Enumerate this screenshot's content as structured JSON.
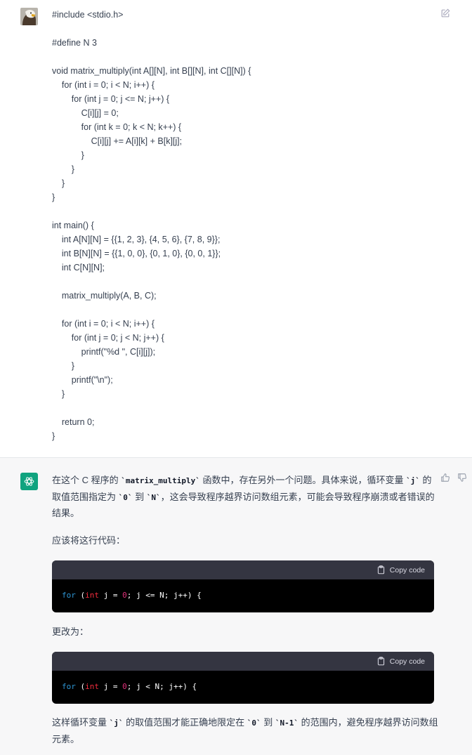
{
  "user_message": {
    "code_lines": [
      "#include <stdio.h>",
      "",
      "#define N 3",
      "",
      "void matrix_multiply(int A[][N], int B[][N], int C[][N]) {",
      "    for (int i = 0; i < N; i++) {",
      "        for (int j = 0; j <= N; j++) {",
      "            C[i][j] = 0;",
      "            for (int k = 0; k < N; k++) {",
      "                C[i][j] += A[i][k] + B[k][j];",
      "            }",
      "        }",
      "    }",
      "}",
      "",
      "int main() {",
      "    int A[N][N] = {{1, 2, 3}, {4, 5, 6}, {7, 8, 9}};",
      "    int B[N][N] = {{1, 0, 0}, {0, 1, 0}, {0, 0, 1}};",
      "    int C[N][N];",
      "",
      "    matrix_multiply(A, B, C);",
      "",
      "    for (int i = 0; i < N; i++) {",
      "        for (int j = 0; j < N; j++) {",
      "            printf(\"%d \", C[i][j]);",
      "        }",
      "        printf(\"\\n\");",
      "    }",
      "",
      "    return 0;",
      "}"
    ]
  },
  "assistant_message": {
    "p1": {
      "t1": "在这个 C 程序的 ",
      "c1": "`matrix_multiply`",
      "t2": " 函数中，存在另外一个问题。具体来说，循环变量 ",
      "c2": "`j`",
      "t3": " 的取值范围指定为 ",
      "c3": "`0`",
      "t4": " 到 ",
      "c4": "`N`",
      "t5": "，这会导致程序越界访问数组元素，可能会导致程序崩溃或者错误的结果。"
    },
    "p2": "应该将这行代码：",
    "code1": {
      "copy_label": "Copy code",
      "kw": "for",
      "p_open": " (",
      "ty": "int",
      "a": " j = ",
      "n": "0",
      "b": "; j <= N; j++) {"
    },
    "p3": "更改为：",
    "code2": {
      "copy_label": "Copy code",
      "kw": "for",
      "p_open": " (",
      "ty": "int",
      "a": " j = ",
      "n": "0",
      "b": "; j < N; j++) {"
    },
    "p4": {
      "t1": "这样循环变量 ",
      "c1": "`j`",
      "t2": " 的取值范围才能正确地限定在 ",
      "c2": "`0`",
      "t3": " 到 ",
      "c3": "`N-1`",
      "t4": " 的范围内，避免程序越界访问数组元素。"
    }
  },
  "icons": {
    "user_avatar": "eagle-avatar",
    "assistant_avatar": "openai-logo-icon",
    "edit": "edit-icon",
    "thumbs_up": "thumbs-up-icon",
    "thumbs_down": "thumbs-down-icon",
    "copy": "clipboard-icon"
  },
  "colors": {
    "assistant_bg": "#f7f7f8",
    "assistant_avatar": "#10a37f",
    "code_header": "#343541",
    "code_body": "#000000",
    "keyword": "#2e95d3",
    "type": "#f22c3d",
    "number": "#df3079"
  }
}
